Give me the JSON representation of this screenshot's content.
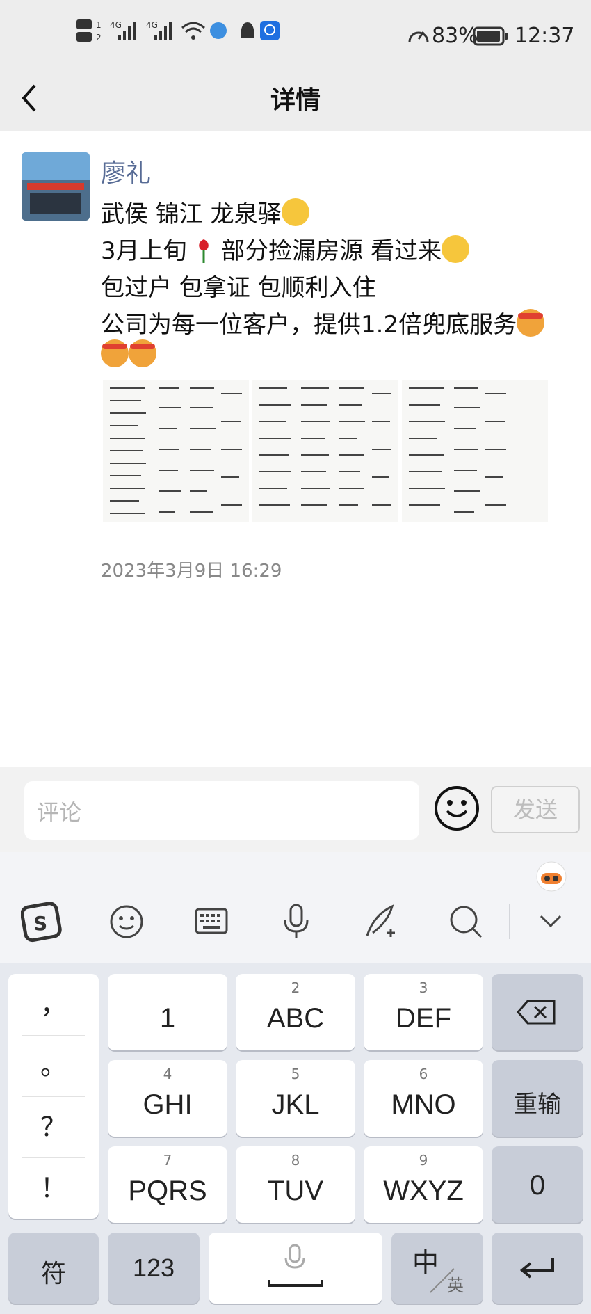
{
  "status_bar": {
    "battery": "83%",
    "time": "12:37"
  },
  "nav": {
    "title": "详情"
  },
  "post": {
    "author": "廖礼",
    "lines": [
      "武侯 锦江 龙泉驿",
      "3月上旬",
      "部分捡漏房源 看过来",
      "包过户 包拿证 包顺利入住",
      "公司为每一位客户，提供1.2倍兜底服务"
    ],
    "timestamp": "2023年3月9日 16:29"
  },
  "comment": {
    "placeholder": "评论",
    "send_label": "发送"
  },
  "keyboard": {
    "punctuation": [
      "，",
      "。",
      "？",
      "！"
    ],
    "rows": [
      [
        {
          "num": "",
          "label": "1"
        },
        {
          "num": "2",
          "label": "ABC"
        },
        {
          "num": "3",
          "label": "DEF"
        }
      ],
      [
        {
          "num": "4",
          "label": "GHI"
        },
        {
          "num": "5",
          "label": "JKL"
        },
        {
          "num": "6",
          "label": "MNO"
        }
      ],
      [
        {
          "num": "7",
          "label": "PQRS"
        },
        {
          "num": "8",
          "label": "TUV"
        },
        {
          "num": "9",
          "label": "WXYZ"
        }
      ]
    ],
    "retype_label": "重输",
    "zero_label": "0",
    "symbols_label": "符",
    "numbers_label": "123",
    "lang_main": "中",
    "lang_alt": "英"
  }
}
